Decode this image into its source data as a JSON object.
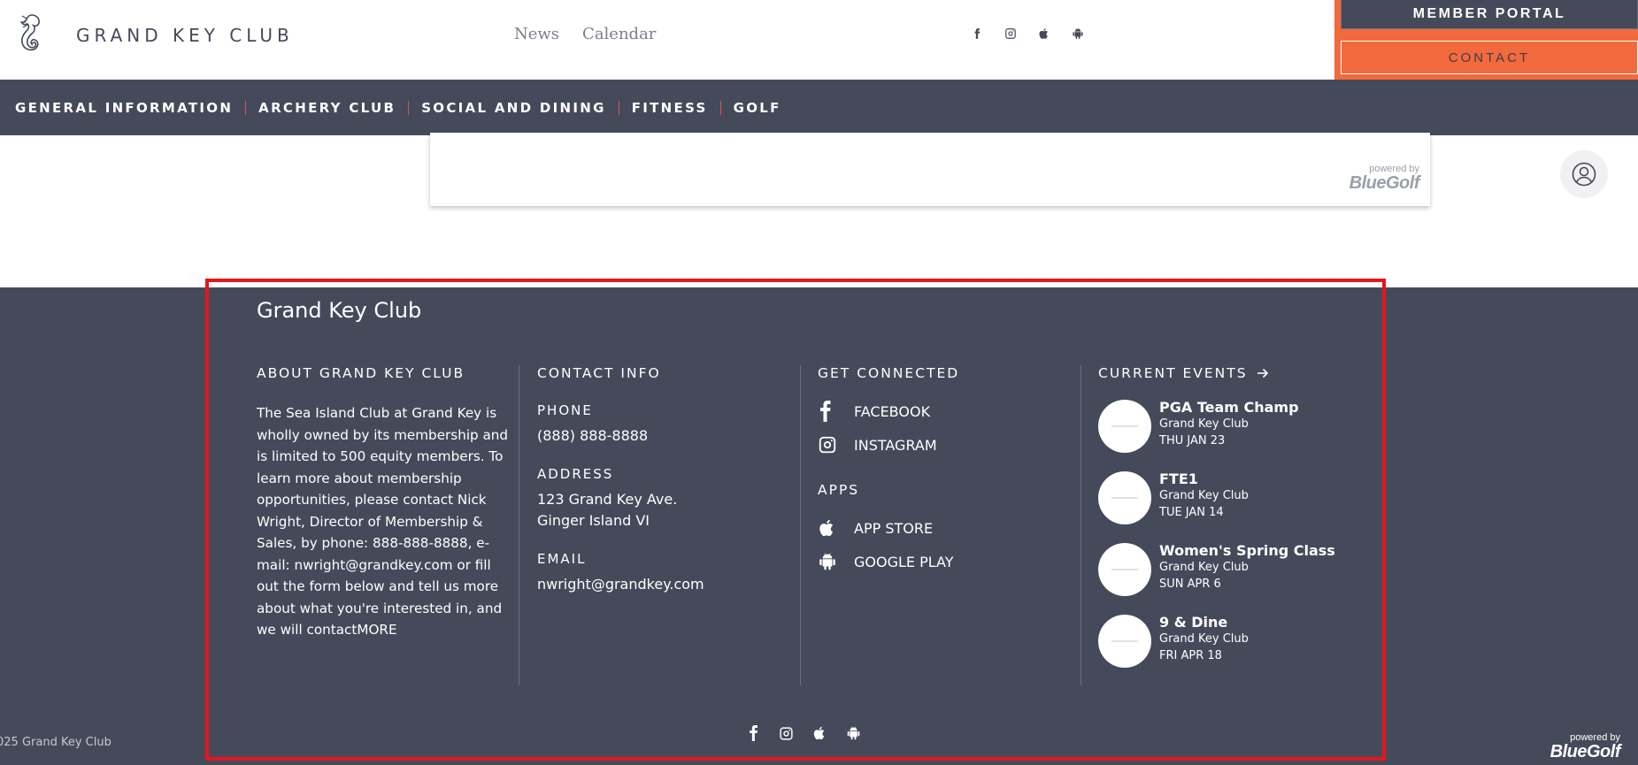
{
  "header": {
    "brand": "GRAND KEY CLUB",
    "top_links": [
      "News",
      "Calendar"
    ],
    "member_portal": "MEMBER PORTAL",
    "contact": "CONTACT"
  },
  "nav": {
    "items": [
      "GENERAL INFORMATION",
      "ARCHERY CLUB",
      "SOCIAL AND DINING",
      "FITNESS",
      "GOLF"
    ]
  },
  "powered_by": {
    "small": "powered by",
    "brand": "BlueGolf"
  },
  "footer": {
    "title": "Grand Key Club",
    "about": {
      "heading": "ABOUT GRAND KEY CLUB",
      "text": "The Sea Island Club at Grand Key is wholly owned by its membership and is limited to 500 equity members. To learn more about membership opportunities, please contact Nick Wright, Director of Membership & Sales, by phone: 888-888-8888, e-mail: nwright@grandkey.com or fill out the form below and tell us more about what you're interested in, and we will contact",
      "more": "MORE"
    },
    "contact": {
      "heading": "CONTACT INFO",
      "phone_label": "PHONE",
      "phone": "(888) 888-8888",
      "address_label": "ADDRESS",
      "address_line1": "123 Grand Key Ave.",
      "address_line2": "Ginger Island VI",
      "email_label": "EMAIL",
      "email": "nwright@grandkey.com"
    },
    "connected": {
      "heading": "GET CONNECTED",
      "facebook": "FACEBOOK",
      "instagram": "INSTAGRAM",
      "apps_heading": "APPS",
      "app_store": "APP STORE",
      "google_play": "GOOGLE PLAY"
    },
    "events": {
      "heading": "CURRENT EVENTS",
      "items": [
        {
          "title": "PGA Team Champ",
          "club": "Grand Key Club",
          "date": "THU JAN 23"
        },
        {
          "title": "FTE1",
          "club": "Grand Key Club",
          "date": "TUE JAN 14"
        },
        {
          "title": "Women's Spring Class",
          "club": "Grand Key Club",
          "date": "SUN APR 6"
        },
        {
          "title": "9 & Dine",
          "club": "Grand Key Club",
          "date": "FRI APR 18"
        }
      ]
    },
    "copyright": "025 Grand Key Club"
  },
  "colors": {
    "slate": "#444a5a",
    "accent": "#f26a3b",
    "highlight": "#e8141b"
  },
  "icons": [
    "seahorse-logo-icon",
    "facebook-icon",
    "instagram-icon",
    "apple-icon",
    "android-icon",
    "user-icon",
    "arrow-right-icon"
  ]
}
